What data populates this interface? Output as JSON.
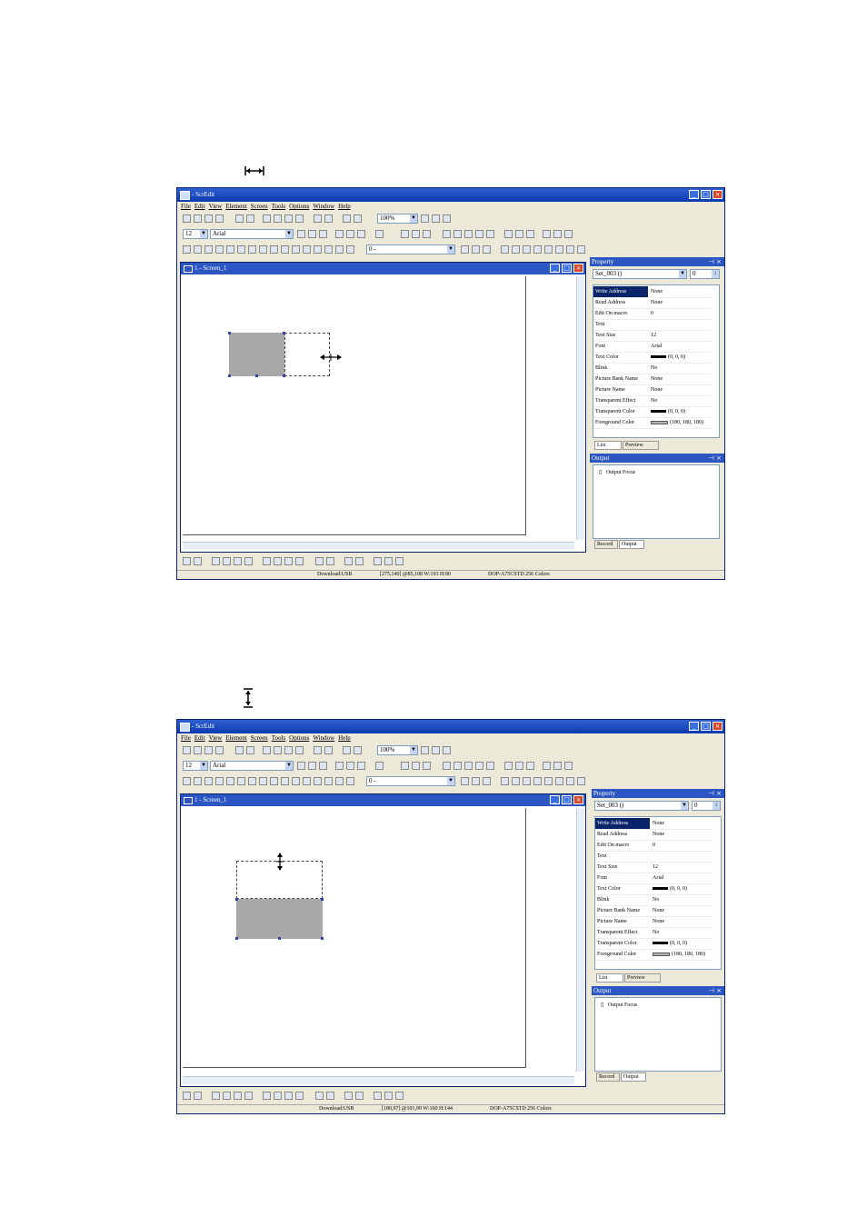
{
  "app": {
    "title": "- ScrEdit",
    "menu": [
      "File",
      "Edit",
      "View",
      "Element",
      "Screen",
      "Tools",
      "Options",
      "Window",
      "Help"
    ],
    "zoom": "100%",
    "font_size": "12",
    "font_name": "Arial",
    "layer": "0 -"
  },
  "document": {
    "title": "1 - Screen_1"
  },
  "property_panel": {
    "title": "Property",
    "object": "Set_003 ()",
    "index": "0",
    "rows": [
      {
        "name": "Write Address",
        "value": "None"
      },
      {
        "name": "Read Address",
        "value": "None"
      },
      {
        "name": "Edit On macro",
        "value": "0"
      },
      {
        "name": "Text",
        "value": ""
      },
      {
        "name": "Text Size",
        "value": "12"
      },
      {
        "name": "Font",
        "value": "Arial"
      },
      {
        "name": "Text Color",
        "value": "(0, 0, 0)"
      },
      {
        "name": "Blink",
        "value": "No"
      },
      {
        "name": "Picture Bank Name",
        "value": "None"
      },
      {
        "name": "Picture Name",
        "value": "None"
      },
      {
        "name": "Transparent Effect",
        "value": "No"
      },
      {
        "name": "Transparent Color",
        "value": "(0, 0, 0)"
      },
      {
        "name": "Foreground Color",
        "value": "(180, 180, 180)"
      }
    ],
    "tabs": [
      "List",
      "Preview"
    ]
  },
  "output_panel": {
    "title": "Output",
    "item": "Output Focus",
    "tabs": [
      "Record",
      "Output"
    ]
  },
  "screenshots": [
    {
      "status": {
        "download": "Download:USB",
        "coords": "[275,140] @85,108 W:193 H:80",
        "model": "DOP-A75CSTD 256 Colors"
      }
    },
    {
      "status": {
        "download": "Download:USB",
        "coords": "[180,97] @101,99 W:160 H:144",
        "model": "DOP-A75CSTD 256 Colors"
      }
    }
  ],
  "colors": {
    "titlebar": "#2f5fd0",
    "shape_fill": "#a8a8a8",
    "text_color_swatch": "#000000",
    "foreground_swatch": "#b4b4b4"
  },
  "icons": [
    "horizontal-resize-icon",
    "vertical-resize-icon"
  ]
}
